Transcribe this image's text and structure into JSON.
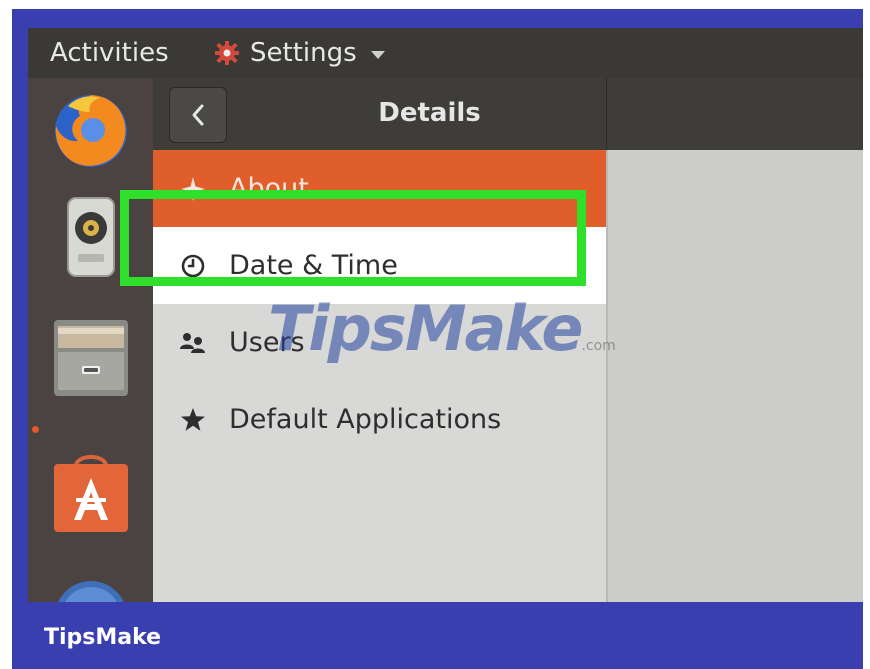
{
  "topbar": {
    "activities_label": "Activities",
    "app_menu_label": "Settings",
    "app_menu_icon": "settings-gear-icon"
  },
  "dock": {
    "items": [
      {
        "name": "firefox",
        "icon": "firefox-icon"
      },
      {
        "name": "rhythmbox",
        "icon": "speaker-icon"
      },
      {
        "name": "files",
        "icon": "file-cabinet-icon"
      },
      {
        "name": "software",
        "icon": "shopping-bag-icon"
      },
      {
        "name": "help",
        "icon": "help-icon"
      }
    ]
  },
  "header": {
    "back_icon": "chevron-left-icon",
    "title": "Details"
  },
  "sidebar": {
    "items": [
      {
        "label": "About",
        "icon": "sparkle-icon",
        "selected": true
      },
      {
        "label": "Date & Time",
        "icon": "clock-icon",
        "highlighted": true
      },
      {
        "label": "Users",
        "icon": "users-icon"
      },
      {
        "label": "Default Applications",
        "icon": "star-icon"
      }
    ]
  },
  "watermark": {
    "text": "TipsMake",
    "suffix": ".com"
  },
  "footer": {
    "brand": "TipsMake"
  },
  "colors": {
    "frame": "#3a3fb0",
    "selected_row": "#e05e2a",
    "highlight_border": "#2ee02a",
    "panel_bg": "#3a3935"
  }
}
